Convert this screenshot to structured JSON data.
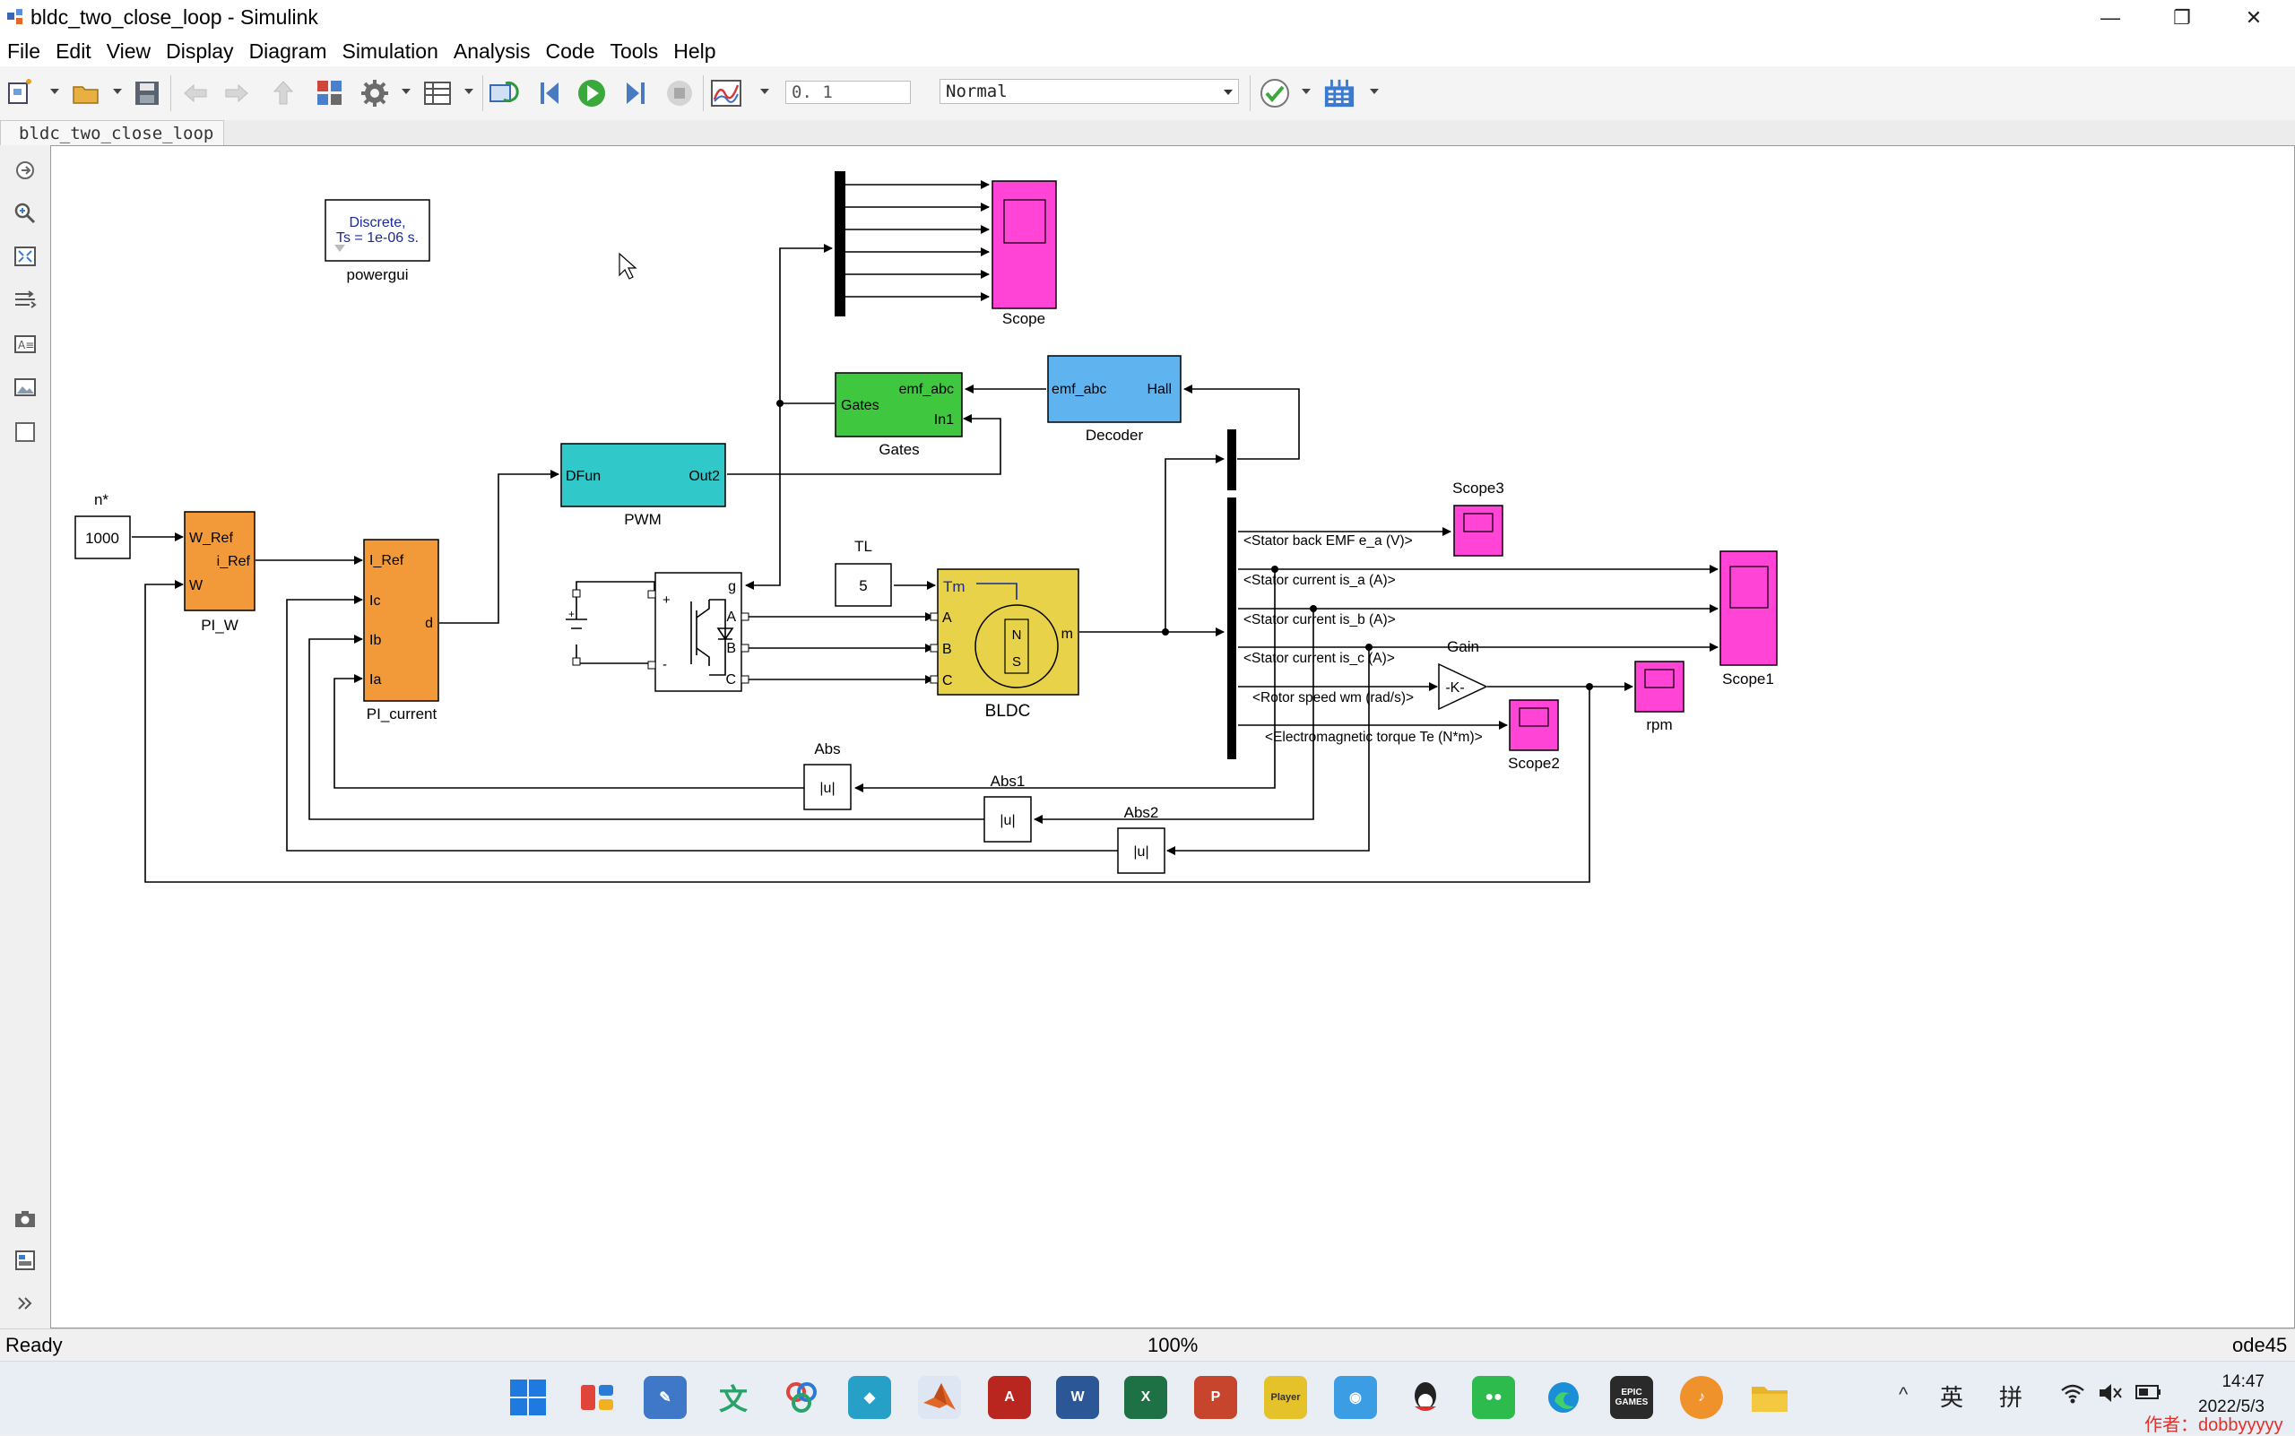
{
  "window": {
    "title": "bldc_two_close_loop - Simulink",
    "minimize_glyph": "—",
    "maximize_glyph": "❐",
    "close_glyph": "✕"
  },
  "menu": [
    "File",
    "Edit",
    "View",
    "Display",
    "Diagram",
    "Simulation",
    "Analysis",
    "Code",
    "Tools",
    "Help"
  ],
  "toolbar": {
    "stop_time": "0. 1",
    "sim_mode": "Normal"
  },
  "tab": {
    "label": "bldc_two_close_loop"
  },
  "diagram": {
    "powergui": {
      "line1": "Discrete,",
      "line2": "Ts = 1e-06 s.",
      "label": "powergui"
    },
    "scope": {
      "label": "Scope"
    },
    "gates": {
      "port_gates": "Gates",
      "port_emf": "emf_abc",
      "port_in1": "In1",
      "label": "Gates"
    },
    "decoder": {
      "port_emf": "emf_abc",
      "port_hall": "Hall",
      "label": "Decoder"
    },
    "pwm": {
      "port_dfun": "DFun",
      "port_out2": "Out2",
      "label": "PWM"
    },
    "constant_n": {
      "value": "1000",
      "label": "n*"
    },
    "pi_w": {
      "port_wref": "W_Ref",
      "port_iref": "i_Ref",
      "port_w": "W",
      "label": "PI_W"
    },
    "pi_current": {
      "port_iref": "I_Ref",
      "port_ic": "Ic",
      "port_ib": "Ib",
      "port_ia": "Ia",
      "port_d": "d",
      "label": "PI_current"
    },
    "inverter": {
      "port_g": "g",
      "port_a": "A",
      "port_b": "B",
      "port_c": "C",
      "plus": "+",
      "minus": "-"
    },
    "tl": {
      "value": "5",
      "label": "TL"
    },
    "bldc": {
      "port_tm": "Tm",
      "port_a": "A",
      "port_b": "B",
      "port_c": "C",
      "port_m": "m",
      "pole_n": "N",
      "pole_s": "S",
      "label": "BLDC"
    },
    "bus_signals": [
      "<Stator back EMF e_a (V)>",
      "<Stator current is_a (A)>",
      "<Stator current is_b (A)>",
      "<Stator current is_c (A)>",
      "<Rotor speed wm (rad/s)>",
      "<Electromagnetic torque Te (N*m)>"
    ],
    "scope3": {
      "label": "Scope3"
    },
    "scope1": {
      "label": "Scope1"
    },
    "gain": {
      "value": "-K-",
      "label": "Gain"
    },
    "rpm": {
      "label": "rpm"
    },
    "scope2": {
      "label": "Scope2"
    },
    "abs": {
      "value": "|u|",
      "label": "Abs"
    },
    "abs1": {
      "value": "|u|",
      "label": "Abs1"
    },
    "abs2": {
      "value": "|u|",
      "label": "Abs2"
    }
  },
  "status": {
    "left": "Ready",
    "zoom": "100%",
    "solver": "ode45"
  },
  "taskbar": {
    "apps": [
      {
        "name": "start",
        "color": "#1f6fd6"
      },
      {
        "name": "widgets",
        "color": "#e0443b"
      },
      {
        "name": "drawing-app",
        "color": "#3f78c8"
      },
      {
        "name": "translator",
        "color": "#2aa36a"
      },
      {
        "name": "network-app",
        "color": "#f08a24"
      },
      {
        "name": "cube-app",
        "color": "#27a0c8"
      },
      {
        "name": "matlab",
        "color": "#d8621f"
      },
      {
        "name": "acrobat",
        "color": "#b8261f"
      },
      {
        "name": "word",
        "color": "#2b5797"
      },
      {
        "name": "excel",
        "color": "#1e7145"
      },
      {
        "name": "powerpoint",
        "color": "#c7452c"
      },
      {
        "name": "player",
        "color": "#e6c22a"
      },
      {
        "name": "bird-app",
        "color": "#3b9de3"
      },
      {
        "name": "qq",
        "color": "#222222"
      },
      {
        "name": "wechat",
        "color": "#2dbb4e"
      },
      {
        "name": "edge",
        "color": "#1a8ed6"
      },
      {
        "name": "epic-games",
        "color": "#2a2a2a"
      },
      {
        "name": "audio-app",
        "color": "#f0922b"
      },
      {
        "name": "file-explorer",
        "color": "#e8b52a"
      }
    ],
    "player_text": "Player",
    "epic_text": "EPIC GAMES",
    "ime_en": "英",
    "ime_pin": "拼",
    "time": "14:47",
    "date": "2022/5/3",
    "watermark": "作者：dobbyyyyy"
  }
}
